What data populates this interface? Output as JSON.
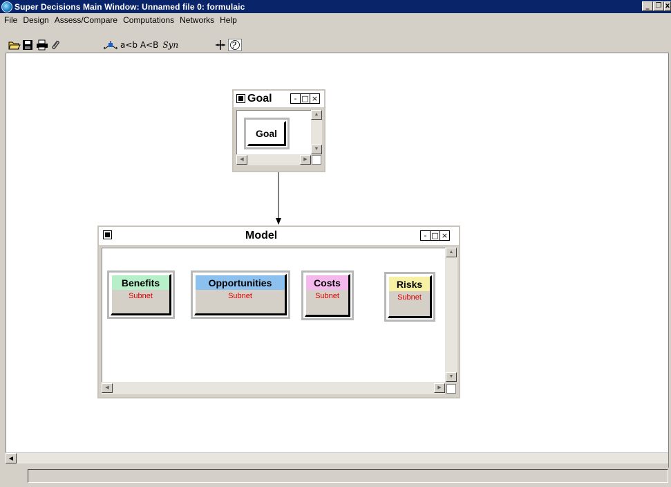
{
  "window": {
    "title": "Super Decisions Main Window: Unnamed file 0: formulaic",
    "minimize": "_",
    "restore": "❐",
    "close": "x"
  },
  "menu": [
    "File",
    "Design",
    "Assess/Compare",
    "Computations",
    "Networks",
    "Help"
  ],
  "toolbar": {
    "compare_text": "a<b A<B",
    "syn_label": "Syn"
  },
  "clusters": {
    "goal": {
      "name": "Goal",
      "nodes": [
        {
          "name": "Goal"
        }
      ]
    },
    "model": {
      "name": "Model",
      "nodes": [
        {
          "name": "Benefits",
          "sub": "Subnet",
          "color": "#b7f0c8"
        },
        {
          "name": "Opportunities",
          "sub": "Subnet",
          "color": "#8cc0ee"
        },
        {
          "name": "Costs",
          "sub": "Subnet",
          "color": "#f4b8ee"
        },
        {
          "name": "Risks",
          "sub": "Subnet",
          "color": "#f7f1a6"
        }
      ]
    }
  },
  "cluster_controls": {
    "min": "-",
    "max": "□",
    "close": "×"
  }
}
